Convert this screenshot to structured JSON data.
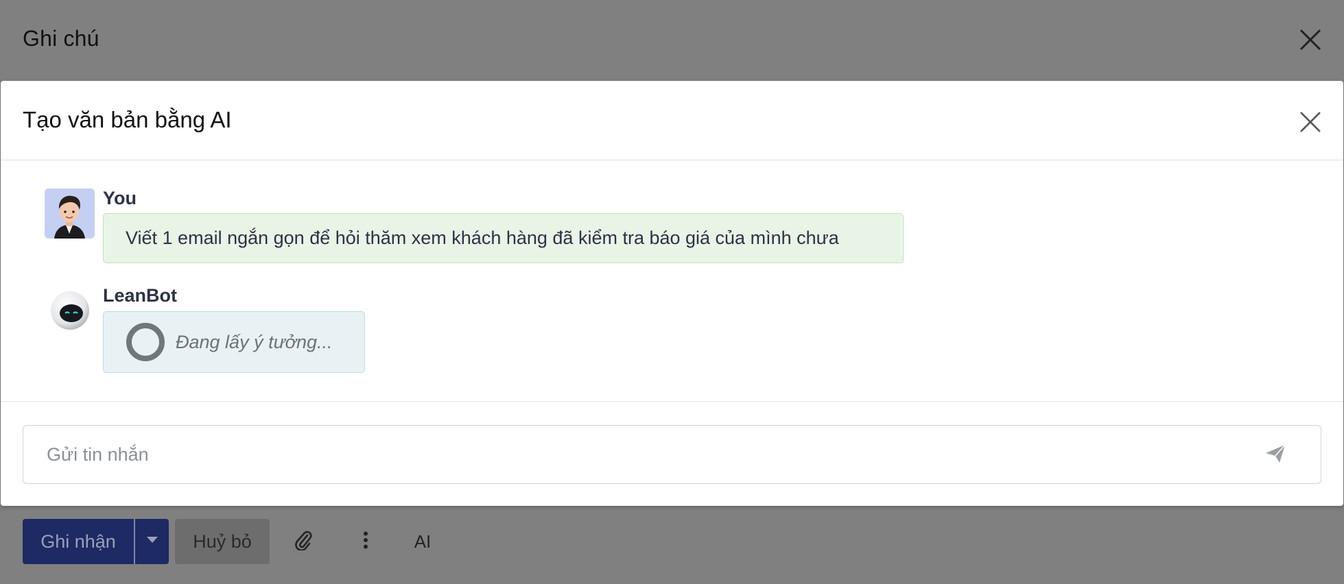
{
  "background_dialog": {
    "title": "Ghi chú",
    "close_icon": "close-icon",
    "actions": {
      "save_label": "Ghi nhận",
      "save_dropdown_icon": "caret-down-icon",
      "cancel_label": "Huỷ bỏ",
      "attach_icon": "paperclip-icon",
      "more_icon": "kebab-menu-icon",
      "ai_label": "AI"
    }
  },
  "modal": {
    "title": "Tạo văn bản bằng AI",
    "close_icon": "close-icon",
    "messages": [
      {
        "sender": "You",
        "avatar": "user-avatar",
        "text": "Viết 1 email ngắn gọn để hỏi thăm xem khách hàng đã kiểm tra báo giá của mình chưa"
      },
      {
        "sender": "LeanBot",
        "avatar": "robot-avatar",
        "status_text": "Đang lấy ý tưởng..."
      }
    ],
    "input": {
      "placeholder": "Gửi tin nhắn",
      "value": "",
      "send_icon": "send-icon"
    }
  },
  "colors": {
    "primary_button": "#1e2a64",
    "user_bubble_bg": "#e8f4e6",
    "user_bubble_border": "#bfe3b8",
    "bot_bubble_bg": "#e8f1f4",
    "bot_bubble_border": "#bfdbe6",
    "overlay": "#808080"
  }
}
